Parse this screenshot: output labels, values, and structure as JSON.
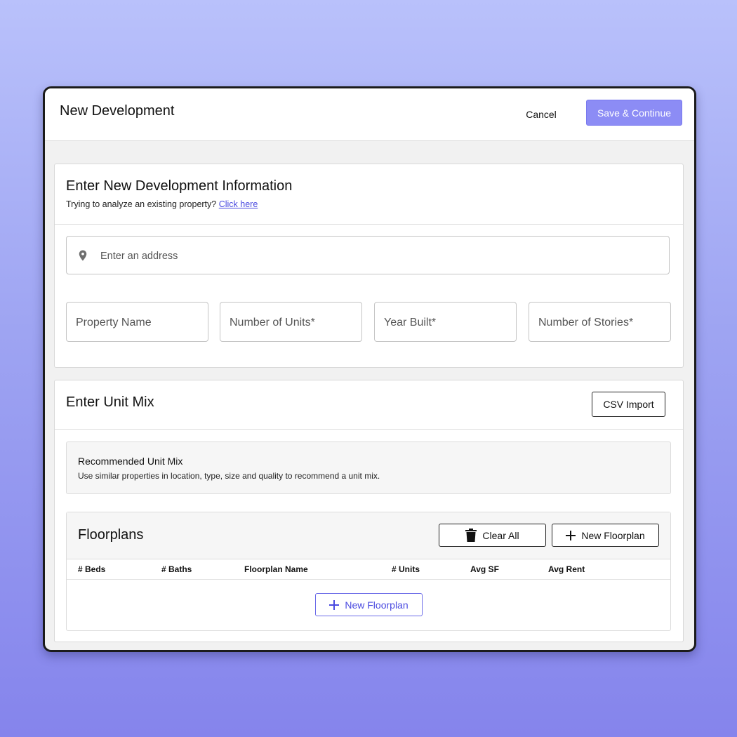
{
  "header": {
    "title": "New Development",
    "cancel_label": "Cancel",
    "save_label": "Save & Continue"
  },
  "info_card": {
    "title": "Enter New Development Information",
    "subtitle": "Trying to analyze an existing property?",
    "link_label": "Click here",
    "address_placeholder": "Enter an address",
    "fields": {
      "property_name": "Property Name",
      "units": "Number of Units*",
      "year_built": "Year Built*",
      "stories": "Number of Stories*"
    }
  },
  "unit_mix": {
    "title": "Enter Unit Mix",
    "csv_label": "CSV Import",
    "recommended": {
      "title": "Recommended Unit Mix",
      "description": "Use similar properties in location, type, size and quality to recommend a unit mix."
    },
    "floorplans": {
      "title": "Floorplans",
      "clear_label": "Clear All",
      "new_label": "New Floorplan",
      "columns": [
        "# Beds",
        "# Baths",
        "Floorplan Name",
        "# Units",
        "Avg SF",
        "Avg Rent"
      ],
      "empty_new_label": "New Floorplan"
    }
  },
  "icons": {
    "location": "location-pin-icon",
    "trash": "trash-icon",
    "plus": "plus-icon"
  },
  "colors": {
    "accent": "#8c8cf5",
    "link": "#4a4ae0"
  }
}
